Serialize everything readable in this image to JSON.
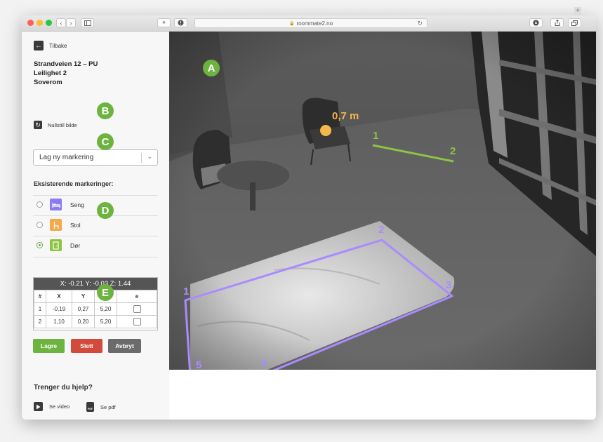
{
  "browser": {
    "url": "roommate2.no",
    "lock_icon": "🔒"
  },
  "sidebar": {
    "back_label": "Tilbake",
    "location": {
      "address": "Strandveien 12 – PU",
      "apartment": "Leilighet 2",
      "room": "Soverom"
    },
    "reset_label": "Nullstill bilde",
    "new_marking_select": {
      "value": "Lag ny markering"
    },
    "existing_title": "Eksisterende markeringer:",
    "markings": [
      {
        "label": "Seng",
        "icon": "bed-icon",
        "color": "#8b7cf6",
        "selected": false
      },
      {
        "label": "Stol",
        "icon": "chair-icon",
        "color": "#f5a94a",
        "selected": false
      },
      {
        "label": "Dør",
        "icon": "door-icon",
        "color": "#8dc443",
        "selected": true
      }
    ],
    "coords": {
      "header": "X: -0.21   Y: -0.03   Z: 1.44",
      "columns": [
        "#",
        "X",
        "Y",
        "Z",
        "e"
      ],
      "rows": [
        {
          "n": "1",
          "x": "-0,19",
          "y": "0,27",
          "z": "5,20"
        },
        {
          "n": "2",
          "x": "1,10",
          "y": "0,20",
          "z": "5,20"
        }
      ]
    },
    "buttons": {
      "save": "Lagre",
      "delete": "Slett",
      "cancel": "Avbryt"
    },
    "help": {
      "title": "Trenger du hjelp?",
      "video_label": "Se video",
      "pdf_label": "Se pdf",
      "pdf_icon_text": "PDF"
    }
  },
  "camera": {
    "distance_label": "0,7 m",
    "door_points": [
      "1",
      "2"
    ],
    "bed_points": [
      "1",
      "2",
      "3",
      "4",
      "5"
    ]
  },
  "callouts": [
    "A",
    "B",
    "C",
    "D",
    "E"
  ],
  "colors": {
    "callout": "#6db33f",
    "bed_line": "#a98bff",
    "door_line": "#8dc443",
    "chair_dot": "#f5b84a",
    "save": "#6db33f",
    "delete": "#d24a3c",
    "cancel": "#6b6b6b"
  }
}
